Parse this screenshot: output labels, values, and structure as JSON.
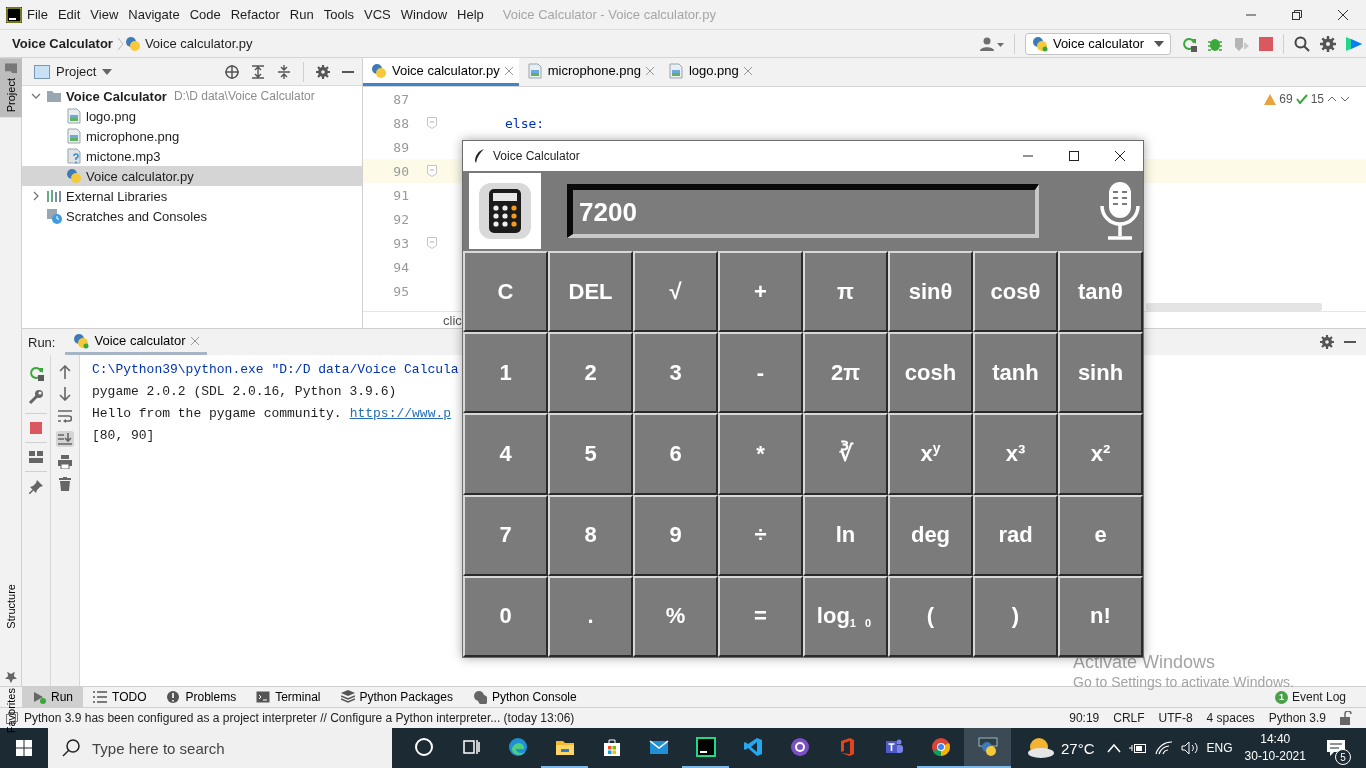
{
  "ide": {
    "menu": [
      "File",
      "Edit",
      "View",
      "Navigate",
      "Code",
      "Refactor",
      "Run",
      "Tools",
      "VCS",
      "Window",
      "Help"
    ],
    "window_title": "Voice Calculator - Voice calculator.py",
    "breadcrumb": [
      {
        "label": "Voice Calculator",
        "kind": "project"
      },
      {
        "label": "Voice calculator.py",
        "kind": "python"
      }
    ],
    "run_config": "Voice calculator",
    "side_stripe": [
      {
        "label": "Project",
        "selected": true
      },
      {
        "label": "Structure",
        "selected": false
      },
      {
        "label": "Favorites",
        "selected": false
      }
    ],
    "project_panel": {
      "title": "Project",
      "tree": [
        {
          "name": "Voice Calculator",
          "path": "D:\\D data\\Voice Calculator",
          "kind": "folder",
          "expanded": true,
          "selected": false,
          "children": [
            {
              "name": "logo.png",
              "kind": "image",
              "selected": false
            },
            {
              "name": "microphone.png",
              "kind": "image",
              "selected": false
            },
            {
              "name": "mictone.mp3",
              "kind": "unknown",
              "selected": false
            },
            {
              "name": "Voice calculator.py",
              "kind": "python",
              "selected": true
            }
          ]
        },
        {
          "name": "External Libraries",
          "kind": "libraries",
          "expanded": false,
          "selected": false
        },
        {
          "name": "Scratches and Consoles",
          "kind": "scratches",
          "selected": false
        }
      ]
    },
    "editor": {
      "tabs": [
        {
          "label": "Voice calculator.py",
          "kind": "python",
          "selected": true
        },
        {
          "label": "microphone.png",
          "kind": "image",
          "selected": false
        },
        {
          "label": "logo.png",
          "kind": "image",
          "selected": false
        }
      ],
      "warnings": "69",
      "passed": "15",
      "lines": [
        {
          "number": "87",
          "fold": false,
          "current": false
        },
        {
          "number": "88",
          "code": "else:",
          "fold": true,
          "current": false
        },
        {
          "number": "89",
          "fold": false,
          "current": false
        },
        {
          "number": "90",
          "fold": true,
          "current": true
        },
        {
          "number": "91",
          "fold": false,
          "current": false
        },
        {
          "number": "92",
          "fold": false,
          "current": false
        },
        {
          "number": "93",
          "fold": true,
          "current": false
        },
        {
          "number": "94",
          "fold": false,
          "current": false
        },
        {
          "number": "95",
          "fold": false,
          "current": false
        }
      ],
      "breadcrumb": "clic"
    },
    "run_panel": {
      "label": "Run:",
      "tab": "Voice calculator",
      "output": [
        {
          "text": "C:\\Python39\\python.exe \"D:/D data/Voice Calcula"
        },
        {
          "text": "pygame 2.0.2 (SDL 2.0.16, Python 3.9.6)"
        },
        {
          "text": "Hello from the pygame community.",
          "link": "https://www.p"
        },
        {
          "text": "[80, 90]"
        }
      ]
    },
    "tool_tabs": [
      {
        "label": "Run",
        "kind": "run",
        "selected": true
      },
      {
        "label": "TODO",
        "kind": "todo",
        "selected": false
      },
      {
        "label": "Problems",
        "kind": "problems",
        "selected": false
      },
      {
        "label": "Terminal",
        "kind": "terminal",
        "selected": false
      },
      {
        "label": "Python Packages",
        "kind": "packages",
        "selected": false
      },
      {
        "label": "Python Console",
        "kind": "console",
        "selected": false
      }
    ],
    "event_log": {
      "label": "Event Log",
      "count": "1"
    },
    "status_bar": {
      "message": "Python 3.9 has been configured as a project interpreter // Configure a Python interpreter... (today 13:06)",
      "items": [
        "90:19",
        "CRLF",
        "UTF-8",
        "4 spaces",
        "Python 3.9"
      ]
    }
  },
  "calculator": {
    "title": "Voice Calculator",
    "display": "7200",
    "keys": [
      [
        "C",
        "DEL",
        "√",
        "+",
        "π",
        "sinθ",
        "cosθ",
        "tanθ"
      ],
      [
        "1",
        "2",
        "3",
        "-",
        "2π",
        "cosh",
        "tanh",
        "sinh"
      ],
      [
        "4",
        "5",
        "6",
        "*",
        "∛",
        "x$^{y}$",
        "x³",
        "x²"
      ],
      [
        "7",
        "8",
        "9",
        "÷",
        "ln",
        "deg",
        "rad",
        "e"
      ],
      [
        "0",
        ".",
        "%",
        "=",
        "log$_{1 0}$",
        "(",
        ")",
        "n!"
      ]
    ]
  },
  "activation_notice": {
    "title": "Activate Windows",
    "text": "Go to Settings to activate Windows."
  },
  "taskbar": {
    "search_placeholder": "Type here to search",
    "apps": [
      {
        "kind": "cortana",
        "running": false,
        "selected": false
      },
      {
        "kind": "taskview",
        "running": false,
        "selected": false
      },
      {
        "kind": "edge",
        "running": false,
        "selected": false
      },
      {
        "kind": "explorer",
        "running": true,
        "selected": false
      },
      {
        "kind": "store",
        "running": false,
        "selected": false
      },
      {
        "kind": "mail",
        "running": false,
        "selected": false
      },
      {
        "kind": "pycharm",
        "running": true,
        "selected": false
      },
      {
        "kind": "vscode",
        "running": false,
        "selected": false
      },
      {
        "kind": "github",
        "running": false,
        "selected": false
      },
      {
        "kind": "office",
        "running": false,
        "selected": false
      },
      {
        "kind": "teams",
        "running": false,
        "selected": false
      },
      {
        "kind": "chrome",
        "running": true,
        "selected": false
      },
      {
        "kind": "python",
        "running": true,
        "selected": true
      }
    ],
    "temperature": "27°C",
    "language": "ENG",
    "time": "14:40",
    "date": "30-10-2021",
    "notifications": "5"
  }
}
